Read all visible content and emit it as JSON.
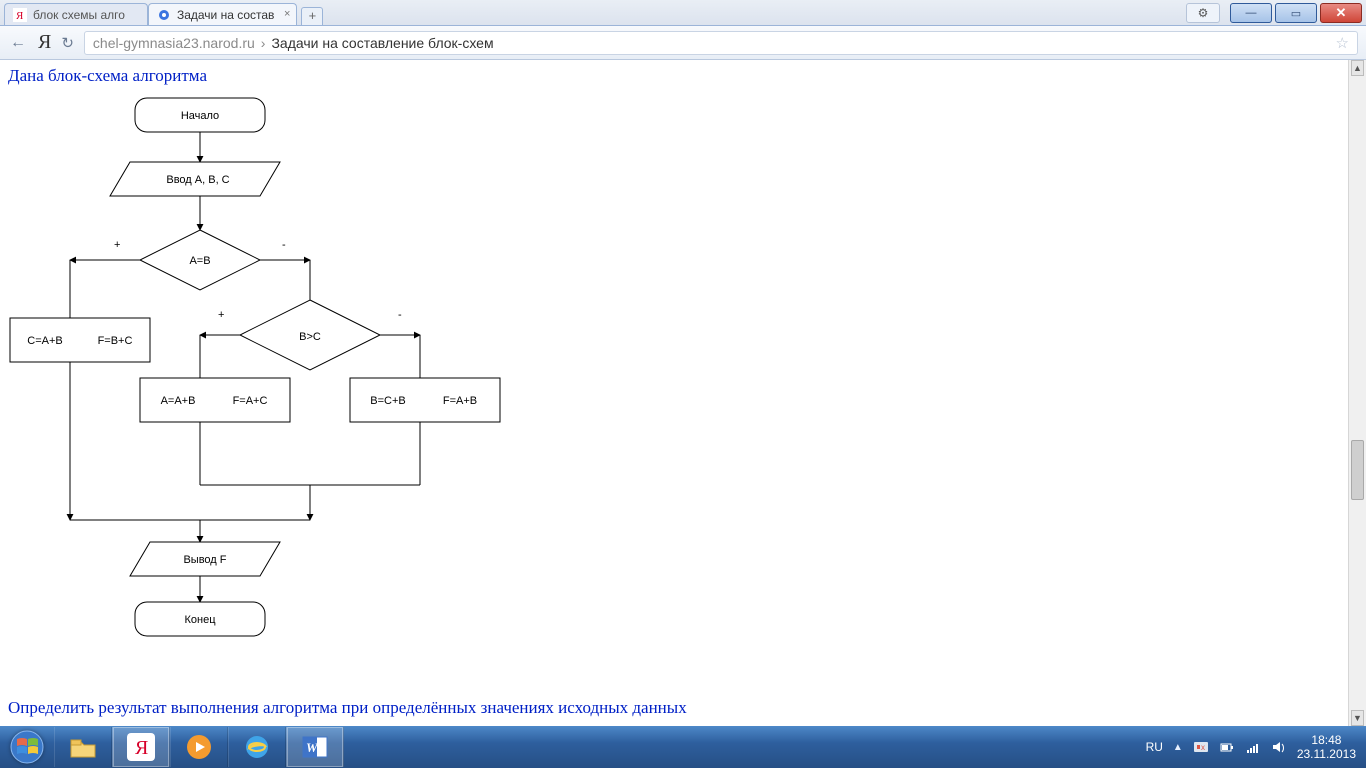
{
  "window": {
    "tabs": [
      {
        "label": "блок схемы алго",
        "favicon": "ya-red"
      },
      {
        "label": "Задачи на состав",
        "favicon": "blue-dot"
      }
    ],
    "gear": "⚙",
    "winmin": "—",
    "winmax": "▭",
    "winclose": "✕"
  },
  "nav": {
    "back": "←",
    "logo": "Я",
    "reload": "↻",
    "domain": "chel-gymnasia23.narod.ru",
    "sep": "›",
    "title": "Задачи на составление блок-схем",
    "star": "☆"
  },
  "page": {
    "heading": "Дана блок-схема алгоритма",
    "footer": "Определить результат выполнения алгоритма при определённых значениях исходных данных"
  },
  "flow": {
    "start": "Начало",
    "input": "Ввод A, B, C",
    "cond1": "A=B",
    "cond2": "B>C",
    "plus": "+",
    "minus": "-",
    "box_left_a": "C=A+B",
    "box_left_b": "F=B+C",
    "box_mid_a": "A=A+B",
    "box_mid_b": "F=A+C",
    "box_right_a": "B=C+B",
    "box_right_b": "F=A+B",
    "output": "Вывод F",
    "end": "Конец"
  },
  "taskbar": {
    "lang": "RU",
    "time": "18:48",
    "date": "23.11.2013"
  }
}
